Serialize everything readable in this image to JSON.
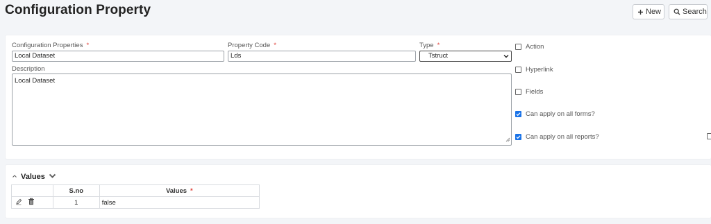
{
  "header": {
    "title": "Configuration Property",
    "new_label": "New",
    "search_label": "Search"
  },
  "form": {
    "config_properties": {
      "label": "Configuration Properties",
      "value": "Local Dataset",
      "required_mark": "*"
    },
    "property_code": {
      "label": "Property Code",
      "value": "Lds",
      "required_mark": "*"
    },
    "type": {
      "label": "Type",
      "value": "Tstruct",
      "required_mark": "*"
    },
    "description": {
      "label": "Description",
      "value": "Local Dataset"
    }
  },
  "options": [
    {
      "label": "Action",
      "checked": false
    },
    {
      "label": "Hyperlink",
      "checked": false
    },
    {
      "label": "Fields",
      "checked": false
    },
    {
      "label": "Can apply on all forms?",
      "checked": true
    },
    {
      "label": "Can apply on all reports?",
      "checked": true
    }
  ],
  "values_section": {
    "title": "Values",
    "columns": {
      "sno": "S.no",
      "values": "Values",
      "required_mark": "*"
    },
    "rows": [
      {
        "sno": "1",
        "value": "false"
      }
    ]
  },
  "icons": [
    "plus-icon",
    "search-icon",
    "chevron-down-icon",
    "caret-up-icon",
    "pencil-icon",
    "trash-icon",
    "resize-grip-icon"
  ],
  "colors": {
    "accent": "#1a73e8",
    "required": "#e0413a",
    "background": "#f3f5f8"
  }
}
